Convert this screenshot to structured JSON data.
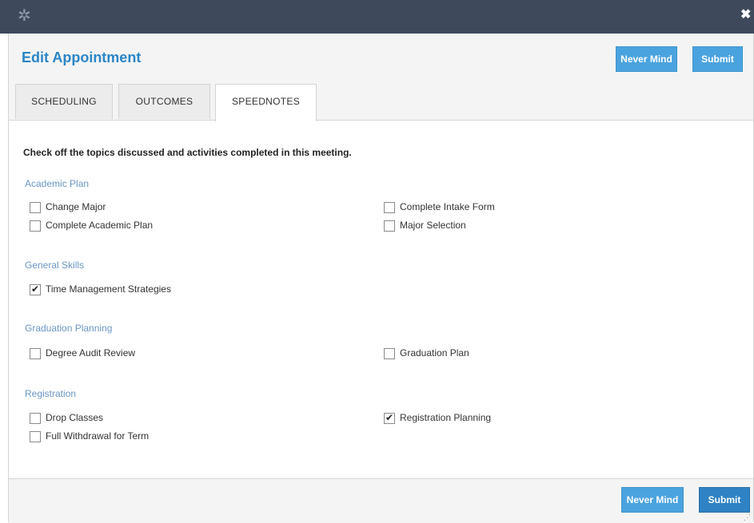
{
  "window": {
    "app_icon": "gear-logo-icon",
    "close_glyph": "✖"
  },
  "dialog": {
    "title": "Edit Appointment",
    "header_buttons": {
      "never_mind": "Never Mind",
      "submit": "Submit"
    },
    "footer_buttons": {
      "never_mind": "Never Mind",
      "submit": "Submit"
    }
  },
  "tabs": [
    {
      "label": "SCHEDULING",
      "active": false
    },
    {
      "label": "OUTCOMES",
      "active": false
    },
    {
      "label": "SPEEDNOTES",
      "active": true
    }
  ],
  "instructions": "Check off the topics discussed and activities completed in this meeting.",
  "sections": [
    {
      "title": "Academic Plan",
      "items": [
        {
          "label": "Change Major",
          "checked": false
        },
        {
          "label": "Complete Intake Form",
          "checked": false
        },
        {
          "label": "Complete Academic Plan",
          "checked": false
        },
        {
          "label": "Major Selection",
          "checked": false
        }
      ]
    },
    {
      "title": "General Skills",
      "items": [
        {
          "label": "Time Management Strategies",
          "checked": true
        }
      ]
    },
    {
      "title": "Graduation Planning",
      "items": [
        {
          "label": "Degree Audit Review",
          "checked": false
        },
        {
          "label": "Graduation Plan",
          "checked": false
        }
      ]
    },
    {
      "title": "Registration",
      "items": [
        {
          "label": "Drop Classes",
          "checked": false
        },
        {
          "label": "Registration Planning",
          "checked": true
        },
        {
          "label": "Full Withdrawal for Term",
          "checked": false
        }
      ]
    }
  ],
  "colors": {
    "topbar": "#3e4a5b",
    "accent": "#2b86c6",
    "button": "#4aa3df",
    "section_title": "#6a96c4"
  }
}
